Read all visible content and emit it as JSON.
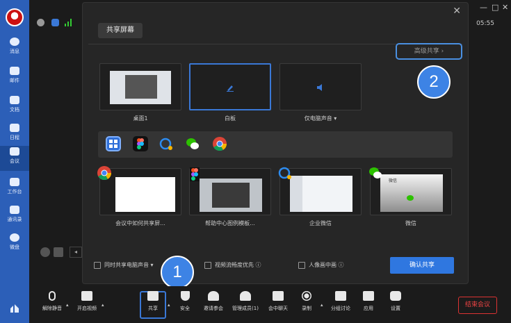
{
  "sidebar": {
    "items": [
      {
        "label": "消息",
        "icon": "chat-icon"
      },
      {
        "label": "邮件",
        "icon": "mail-icon"
      },
      {
        "label": "文档",
        "icon": "doc-icon"
      },
      {
        "label": "日程",
        "icon": "calendar-icon"
      },
      {
        "label": "会议",
        "icon": "meeting-icon"
      },
      {
        "label": "工作台",
        "icon": "grid-icon"
      },
      {
        "label": "通讯录",
        "icon": "contacts-icon"
      },
      {
        "label": "微盘",
        "icon": "drive-icon"
      }
    ]
  },
  "topbar": {
    "clock": "05:55",
    "window_buttons": [
      "—",
      "□",
      "✕"
    ]
  },
  "dialog": {
    "title": "共享屏幕",
    "close": "✕",
    "advanced": "高级共享 ›",
    "sources": [
      {
        "label": "桌面1"
      },
      {
        "label": "白板"
      },
      {
        "label": "仅电脑声音 ▾"
      }
    ],
    "windows": [
      {
        "label": "会议中如何共享屏..."
      },
      {
        "label": "帮助中心图例模板..."
      },
      {
        "label": "企业微信"
      },
      {
        "label": "微信"
      }
    ],
    "wechat_window_title": "微信",
    "options": [
      {
        "label": "同时共享电脑声音 ▾"
      },
      {
        "label": "视频流畅度优先 ⓘ"
      },
      {
        "label": "人像画中画 ⓘ"
      }
    ],
    "confirm": "确认共享"
  },
  "badges": {
    "one": "1",
    "two": "2"
  },
  "toolbar": {
    "buttons": [
      {
        "label": "解除静音",
        "icon": "mic-off-icon"
      },
      {
        "label": "开启视频",
        "icon": "video-off-icon"
      },
      {
        "label": "共享",
        "icon": "share-screen-icon"
      },
      {
        "label": "安全",
        "icon": "shield-icon"
      },
      {
        "label": "邀请参会",
        "icon": "invite-icon"
      },
      {
        "label": "管理成员(1)",
        "icon": "members-icon"
      },
      {
        "label": "会中聊天",
        "icon": "chat-icon"
      },
      {
        "label": "录制",
        "icon": "record-icon"
      },
      {
        "label": "分组讨论",
        "icon": "breakout-icon"
      },
      {
        "label": "应用",
        "icon": "apps-icon"
      },
      {
        "label": "设置",
        "icon": "settings-icon"
      }
    ],
    "end": "结束会议"
  }
}
